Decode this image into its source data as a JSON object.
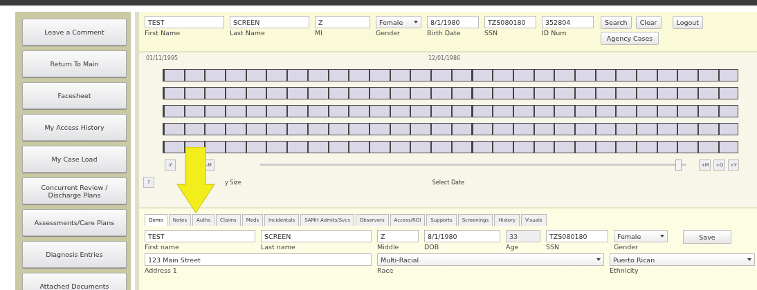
{
  "sidebar": {
    "items": [
      {
        "label": "Leave a Comment"
      },
      {
        "label": "Return To Main"
      },
      {
        "label": "Facesheet"
      },
      {
        "label": "My Access History"
      },
      {
        "label": "My Case Load"
      },
      {
        "label": "Concurrent Review / Discharge Plans"
      },
      {
        "label": "Assessments/Care Plans"
      },
      {
        "label": "Diagnosis Entries"
      },
      {
        "label": "Attached Documents"
      }
    ]
  },
  "search": {
    "fields": [
      {
        "kind": "text",
        "value": "TEST",
        "label": "First Name"
      },
      {
        "kind": "text",
        "value": "SCREEN",
        "label": "Last Name"
      },
      {
        "kind": "text",
        "value": "Z",
        "label": "MI"
      },
      {
        "kind": "select",
        "value": "Female",
        "label": "Gender"
      },
      {
        "kind": "text",
        "value": "8/1/1980",
        "label": "Birth Date"
      },
      {
        "kind": "text",
        "value": "TZS080180",
        "label": "SSN"
      },
      {
        "kind": "text",
        "value": "352804",
        "label": "ID Num"
      }
    ],
    "buttons": [
      "Search",
      "Clear"
    ],
    "agency_button": "Agency Cases",
    "logout": "Logout"
  },
  "timeline": {
    "start_date": "01/11/1995",
    "mid_date": "12/01/1986",
    "tracks": [
      {
        "kind": "cells"
      },
      {
        "kind": "cells"
      },
      {
        "kind": "cells"
      },
      {
        "kind": "cells"
      },
      {
        "kind": "cells"
      }
    ],
    "left_buttons": [
      "-Y",
      "-M"
    ],
    "help": "?",
    "size_label": "y Size",
    "select_label": "Select Date",
    "slider": {
      "level": 0.99
    },
    "right_buttons": [
      "+M",
      "+Q",
      "+Y"
    ]
  },
  "tabs": [
    {
      "label": "Demo",
      "selected": true
    },
    {
      "label": "Notes",
      "selected": false
    },
    {
      "label": "Auths",
      "selected": false
    },
    {
      "label": "Claims",
      "selected": false
    },
    {
      "label": "Meds",
      "selected": false
    },
    {
      "label": "Incidentals",
      "selected": false
    },
    {
      "label": "SAMH Admits/Svcs",
      "selected": false
    },
    {
      "label": "Observers",
      "selected": false
    },
    {
      "label": "Access/ROI",
      "selected": false
    },
    {
      "label": "Supports",
      "selected": false
    },
    {
      "label": "Screenings",
      "selected": false
    },
    {
      "label": "History",
      "selected": false
    },
    {
      "label": "Visuals",
      "selected": false
    }
  ],
  "form": {
    "rows": [
      {
        "fields": [
          {
            "kind": "text",
            "value": "TEST",
            "label": "First name"
          },
          {
            "kind": "text",
            "value": "SCREEN",
            "label": "Last name"
          },
          {
            "kind": "text",
            "value": "Z",
            "label": "Middle"
          },
          {
            "kind": "text",
            "value": "8/1/1980",
            "label": "DOB"
          },
          {
            "kind": "text",
            "value": "33",
            "label": "Age",
            "disabled": true
          },
          {
            "kind": "text",
            "value": "TZS080180",
            "label": "SSN"
          },
          {
            "kind": "select",
            "value": "Female",
            "label": "Gender"
          }
        ],
        "button": "Save"
      },
      {
        "fields": [
          {
            "kind": "text",
            "value": "123 Main Street",
            "label": "Address 1"
          },
          {
            "kind": "select",
            "value": "Multi-Racial",
            "label": "Race"
          },
          {
            "kind": "select",
            "value": "Puerto Rican",
            "label": "Ethnicity"
          }
        ]
      }
    ]
  }
}
